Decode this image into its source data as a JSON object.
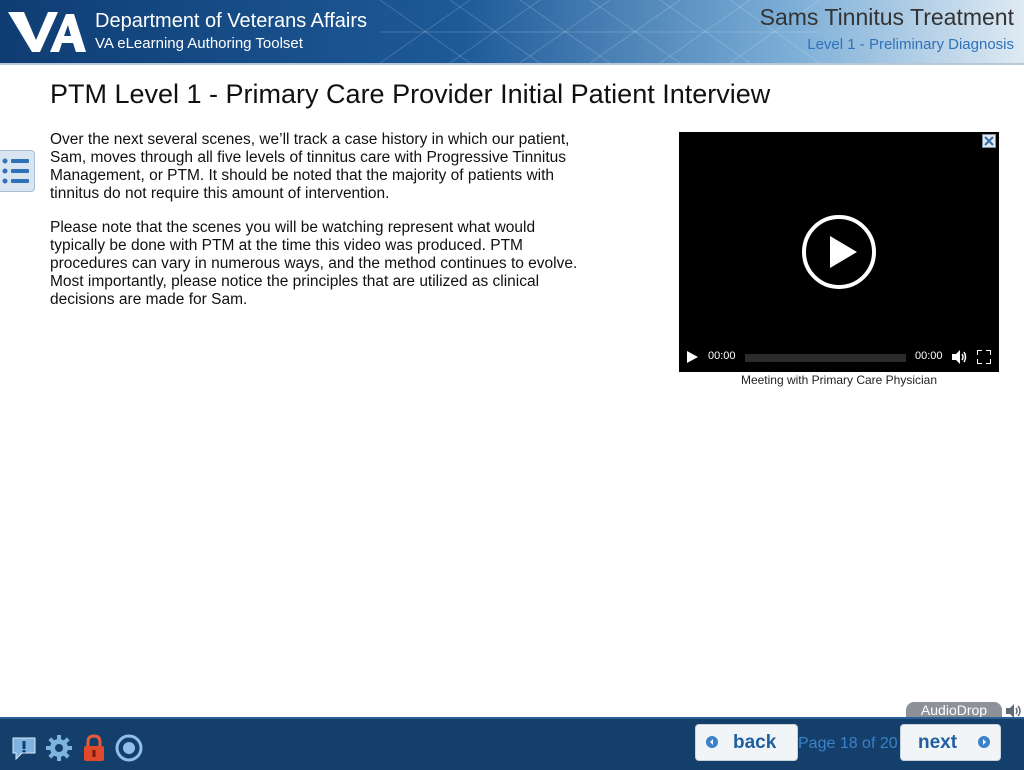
{
  "header": {
    "organization": "Department of Veterans Affairs",
    "toolset": "VA eLearning Authoring Toolset",
    "logo_text": "VA",
    "course_title": "Sams Tinnitus Treatment",
    "course_level": "Level 1 - Preliminary Diagnosis"
  },
  "page": {
    "title": "PTM Level 1 - Primary Care Provider Initial Patient Interview",
    "paragraphs": [
      "Over the next several scenes, we’ll track a case history in which our patient, Sam, moves through all five levels of tinnitus care with Progressive Tinnitus Management, or PTM. It should be noted that the majority of patients with tinnitus do not require this amount of intervention.",
      "Please note that the scenes you will be watching represent what would typically be done with PTM at the time this video was produced. PTM procedures can vary in numerous ways, and the method continues to evolve. Most importantly, please notice the principles that are utilized as clinical decisions are made for Sam."
    ]
  },
  "video": {
    "current_time": "00:00",
    "duration": "00:00",
    "caption": "Meeting with Primary Care Physician",
    "progress": 0
  },
  "footer": {
    "audiodrop_label": "AudioDrop",
    "back_label": "back",
    "next_label": "next",
    "page_indicator": "Page 18 of 20",
    "icons": [
      "help-icon",
      "settings-icon",
      "lock-icon",
      "target-icon"
    ]
  },
  "colors": {
    "header_dark": "#0f3d73",
    "footer_bg": "#153f6b",
    "accent_blue": "#2f72b8",
    "page_indicator": "#3b82c8"
  }
}
